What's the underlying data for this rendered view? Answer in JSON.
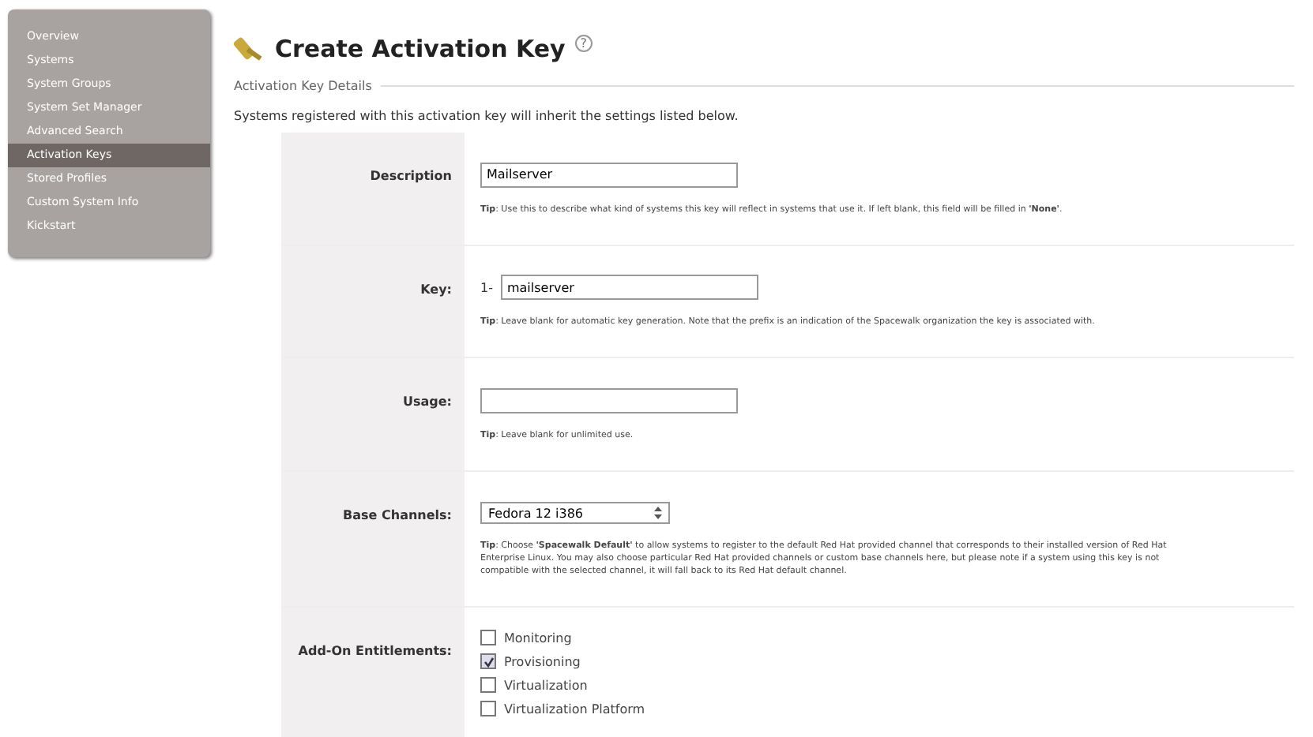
{
  "sidebar": {
    "items": [
      {
        "label": "Overview",
        "selected": false
      },
      {
        "label": "Systems",
        "selected": false
      },
      {
        "label": "System Groups",
        "selected": false
      },
      {
        "label": "System Set Manager",
        "selected": false
      },
      {
        "label": "Advanced Search",
        "selected": false
      },
      {
        "label": "Activation Keys",
        "selected": true
      },
      {
        "label": "Stored Profiles",
        "selected": false
      },
      {
        "label": "Custom System Info",
        "selected": false
      },
      {
        "label": "Kickstart",
        "selected": false
      }
    ]
  },
  "page": {
    "title": "Create Activation Key",
    "help": "?",
    "section": "Activation Key Details",
    "intro": "Systems registered with this activation key will inherit the settings listed below."
  },
  "form": [
    {
      "kind": "text",
      "label": "Description",
      "value": "Mailserver",
      "tip": "**Tip**: Use this to describe what kind of systems this key will reflect in systems that use it. If left blank, this field will be filled in **'None'**."
    },
    {
      "kind": "key",
      "label": "Key:",
      "prefix": "1-",
      "value": "mailserver",
      "tip": "**Tip**: Leave blank for automatic key generation. Note that the prefix is an indication of the Spacewalk organization the key is associated with."
    },
    {
      "kind": "text",
      "label": "Usage:",
      "tip": "**Tip**: Leave blank for unlimited use."
    },
    {
      "kind": "select",
      "label": "Base Channels:",
      "value": "Fedora 12 i386",
      "tip": "**Tip**: Choose **'Spacewalk Default'** to allow systems to register to the default Red Hat provided channel that corresponds to their installed version of Red Hat Enterprise Linux. You may also choose particular Red Hat provided channels or custom base channels here, but please note if a system using this key is not compatible with the selected channel, it will fall back to its Red Hat default channel."
    },
    {
      "kind": "checks",
      "label": "Add-On Entitlements:",
      "options": [
        {
          "label": "Monitoring",
          "checked": false
        },
        {
          "label": "Provisioning",
          "checked": true
        },
        {
          "label": "Virtualization",
          "checked": false
        },
        {
          "label": "Virtualization Platform",
          "checked": false
        }
      ]
    }
  ]
}
